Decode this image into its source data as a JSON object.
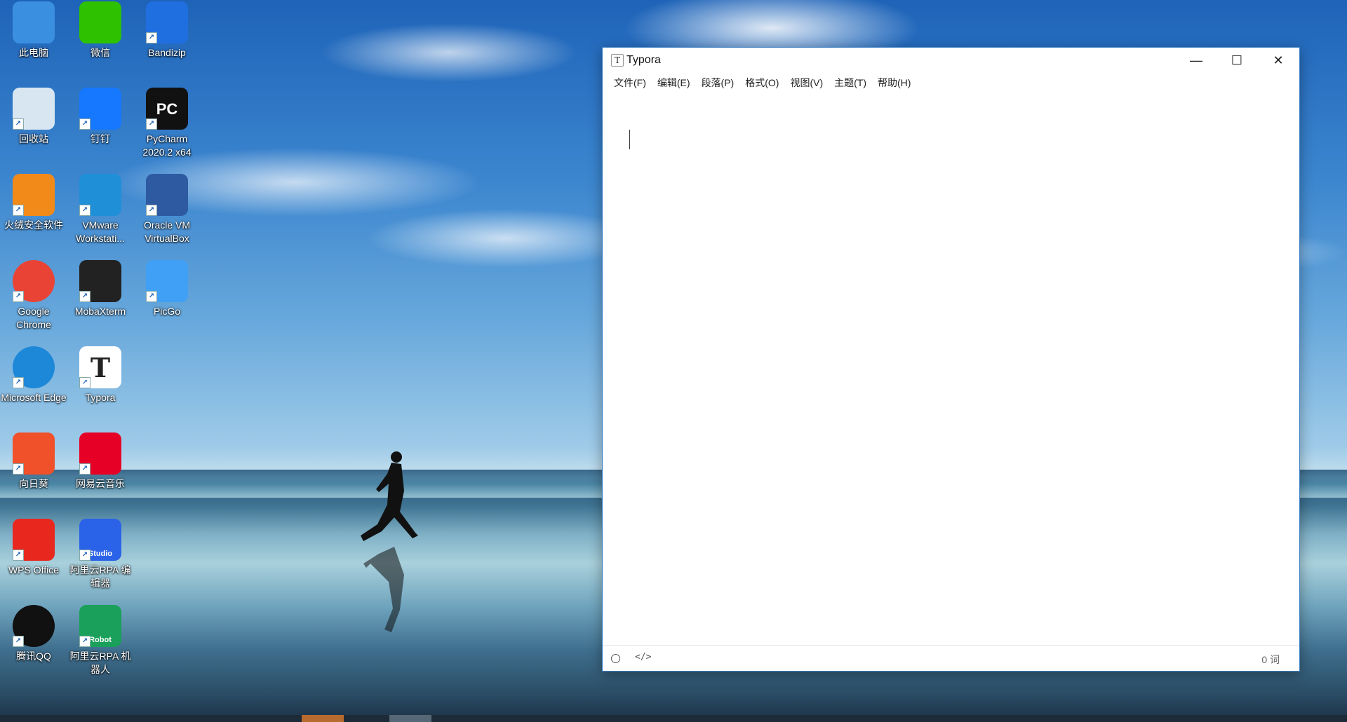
{
  "desktop": {
    "icons": [
      {
        "label": "此电脑",
        "icon": "computer-icon",
        "color": "#3b8fe0"
      },
      {
        "label": "微信",
        "icon": "wechat-icon",
        "color": "#2dc100"
      },
      {
        "label": "Bandizip",
        "icon": "bandizip-icon",
        "color": "#1f6fe0"
      },
      {
        "label": "回收站",
        "icon": "recycle-bin-icon",
        "color": "#d8e6f2"
      },
      {
        "label": "钉钉",
        "icon": "dingtalk-icon",
        "color": "#1677ff"
      },
      {
        "label": "PyCharm 2020.2 x64",
        "icon": "pycharm-icon",
        "color": "#111111"
      },
      {
        "label": "火绒安全软件",
        "icon": "huorong-icon",
        "color": "#f28a1a"
      },
      {
        "label": "VMware Workstati...",
        "icon": "vmware-icon",
        "color": "#1f8fd8"
      },
      {
        "label": "Oracle VM VirtualBox",
        "icon": "virtualbox-icon",
        "color": "#2d5aa0"
      },
      {
        "label": "Google Chrome",
        "icon": "chrome-icon",
        "color": "#e94335"
      },
      {
        "label": "MobaXterm",
        "icon": "mobaxterm-icon",
        "color": "#222222"
      },
      {
        "label": "PicGo",
        "icon": "picgo-icon",
        "color": "#3fa0f5"
      },
      {
        "label": "Microsoft Edge",
        "icon": "edge-icon",
        "color": "#1e88d8"
      },
      {
        "label": "Typora",
        "icon": "typora-icon",
        "color": "#ffffff"
      },
      {
        "label": "向日葵",
        "icon": "sunlogin-icon",
        "color": "#f0502a"
      },
      {
        "label": "网易云音乐",
        "icon": "netease-music-icon",
        "color": "#e60026"
      },
      {
        "label": "WPS Office",
        "icon": "wps-icon",
        "color": "#e8281f"
      },
      {
        "label": "阿里云RPA 编辑器",
        "icon": "aliyun-rpa-studio-icon",
        "color": "#2a62e8"
      },
      {
        "label": "腾讯QQ",
        "icon": "qq-icon",
        "color": "#111111"
      },
      {
        "label": "阿里云RPA 机器人",
        "icon": "aliyun-rpa-robot-icon",
        "color": "#1aa05a"
      }
    ],
    "icon_text": {
      "pycharm": "PC",
      "typora": "T",
      "studio": "Studio",
      "robot": "Robot"
    }
  },
  "window": {
    "title": "Typora",
    "app_icon_glyph": "T",
    "controls": {
      "minimize": "—",
      "maximize": "☐",
      "close": "✕"
    },
    "menu": [
      "文件(F)",
      "编辑(E)",
      "段落(P)",
      "格式(O)",
      "视图(V)",
      "主题(T)",
      "帮助(H)"
    ],
    "status": {
      "source_toggle": "</>",
      "word_count": "0 词"
    },
    "accent": "#3c7fc4"
  }
}
